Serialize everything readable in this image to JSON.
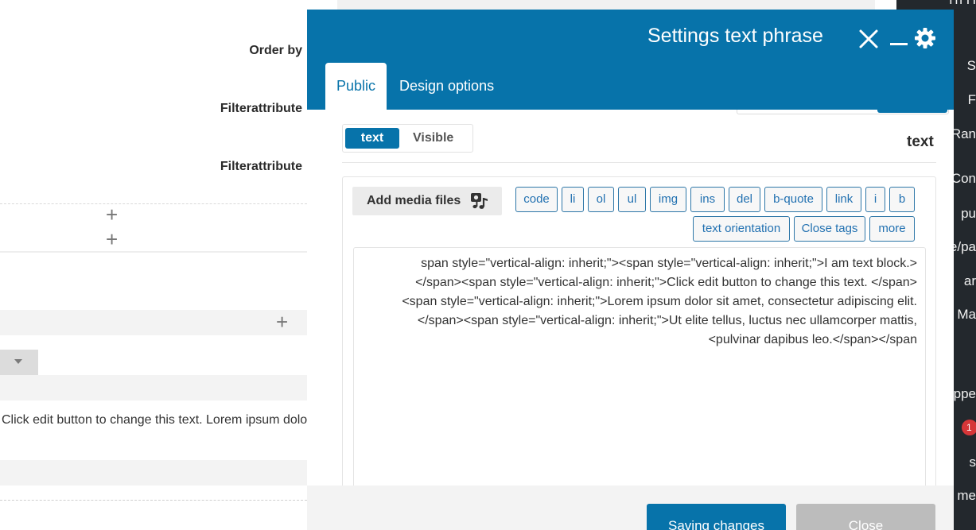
{
  "background": {
    "labels": [
      "Order by",
      "Filterattribute",
      "Filterattribute"
    ],
    "text_preview": "Click edit button to change this text. Lorem ipsum dolor sit amet"
  },
  "admin_menu": {
    "items": [
      "Th H",
      "S",
      "F",
      "Ran",
      "Con",
      "pu",
      "e/pa",
      "ar",
      "Ma",
      "appe",
      "s",
      "me"
    ],
    "badge": "1"
  },
  "modal": {
    "title": "Settings text phrase",
    "tabs": [
      "Public",
      "Design options"
    ],
    "toggle": {
      "on": "text",
      "off": "Visible"
    },
    "field_label": "text",
    "media_button": "Add media files",
    "quicktags_row1": [
      "code",
      "li",
      "ol",
      "ul",
      "img",
      "ins",
      "del",
      "b-quote",
      "link",
      "i",
      "b"
    ],
    "quicktags_row2": [
      "text orientation",
      "Close tags",
      "more"
    ],
    "content_lines": [
      "span style=\"vertical-align: inherit;\"><span style=\"vertical-align: inherit;\">I am text block.>",
      "</span><span style=\"vertical-align: inherit;\">Click edit button to change this text. </span>",
      "<span style=\"vertical-align: inherit;\">Lorem ipsum dolor sit amet, consectetur adipiscing elit.",
      "</span><span style=\"vertical-align: inherit;\">Ut elite tellus, luctus nec ullamcorper mattis,",
      "<pulvinar dapibus leo.</span></span"
    ],
    "save_button": "Saving changes",
    "close_button": "Close"
  },
  "colors": {
    "primary": "#0773aa",
    "admin_bar": "#23282d",
    "badge": "#d63638"
  }
}
